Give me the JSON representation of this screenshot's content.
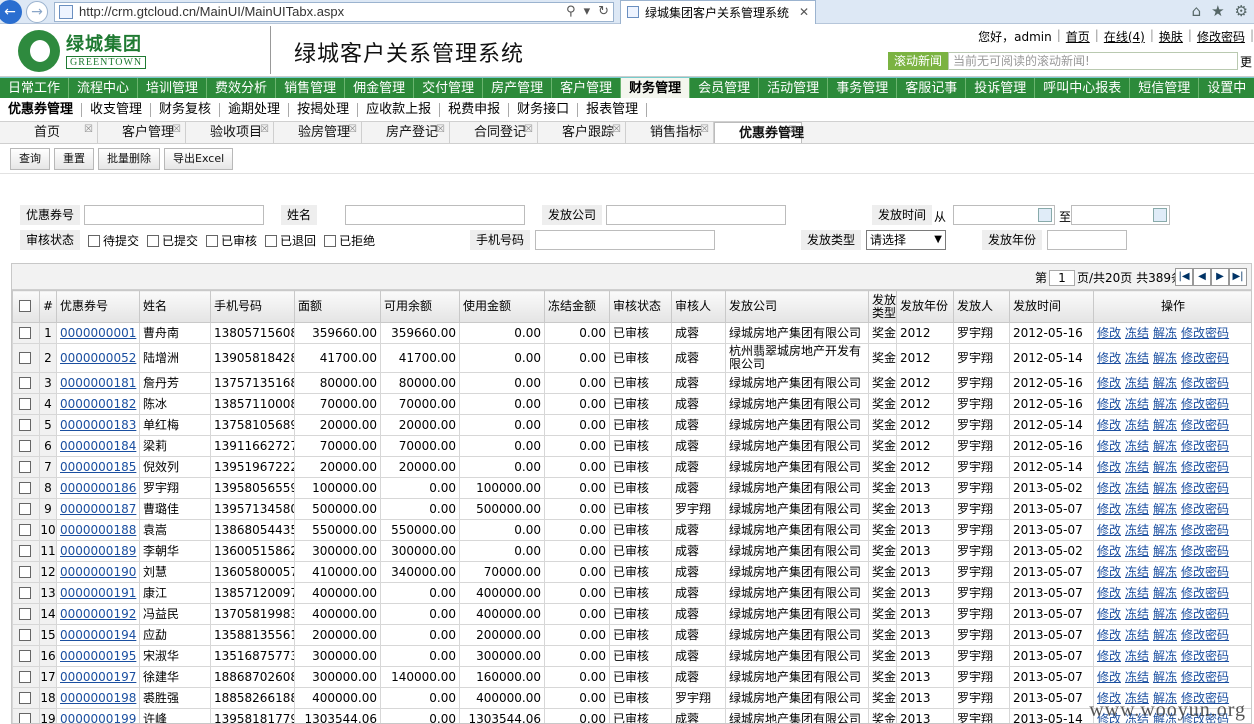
{
  "browser": {
    "url": "http://crm.gtcloud.cn/MainUI/MainUITabx.aspx",
    "tab_title": "绿城集团客户关系管理系统"
  },
  "logo": {
    "cn": "绿城集团",
    "en": "GREENTOWN"
  },
  "system_title": "绿城客户关系管理系统",
  "user": {
    "greeting": "您好，admin",
    "home": "首页",
    "online": "在线(4)",
    "skin": "换肤",
    "change_password": "修改密码"
  },
  "news": {
    "label": "滚动新闻",
    "text": "当前无可阅读的滚动新闻!",
    "more": "更"
  },
  "main_nav": [
    "日常工作",
    "流程中心",
    "培训管理",
    "费效分析",
    "销售管理",
    "佣金管理",
    "交付管理",
    "房产管理",
    "客户管理",
    "财务管理",
    "会员管理",
    "活动管理",
    "事务管理",
    "客服记事",
    "投诉管理",
    "呼叫中心报表",
    "短信管理",
    "设置中"
  ],
  "main_nav_active": 9,
  "sub_nav": [
    "优惠券管理",
    "收支管理",
    "财务复核",
    "逾期处理",
    "按揭处理",
    "应收款上报",
    "税费申报",
    "财务接口",
    "报表管理"
  ],
  "page_tabs": [
    "首页",
    "客户管理",
    "验收项目",
    "验房管理",
    "房产登记",
    "合同登记",
    "客户跟踪",
    "销售指标",
    "优惠券管理"
  ],
  "toolbar": [
    "查询",
    "重置",
    "批量删除",
    "导出Excel"
  ],
  "filters": {
    "coupon_no": "优惠券号",
    "name": "姓名",
    "issuer": "发放公司",
    "issue_time": "发放时间",
    "from": "从",
    "to": "至",
    "audit_status": "审核状态",
    "statuses": [
      "待提交",
      "已提交",
      "已审核",
      "已退回",
      "已拒绝"
    ],
    "phone": "手机号码",
    "issue_type": "发放类型",
    "issue_type_value": "请选择",
    "issue_year": "发放年份"
  },
  "pager": {
    "prefix": "第",
    "page": "1",
    "suffix": "页/共20页 共389条"
  },
  "columns": [
    "#",
    "优惠券号",
    "姓名",
    "手机号码",
    "面额",
    "可用余额",
    "使用金额",
    "冻结金额",
    "审核状态",
    "审核人",
    "发放公司",
    "发放类型",
    "发放年份",
    "发放人",
    "发放时间",
    "操作"
  ],
  "ops": [
    "修改",
    "冻结",
    "解冻",
    "修改密码"
  ],
  "rows": [
    [
      "1",
      "0000000001",
      "曹舟南",
      "13805715608",
      "359660.00",
      "359660.00",
      "0.00",
      "0.00",
      "已审核",
      "成蓉",
      "绿城房地产集团有限公司",
      "奖金",
      "2012",
      "罗宇翔",
      "2012-05-16"
    ],
    [
      "2",
      "0000000052",
      "陆增洲",
      "13905818428",
      "41700.00",
      "41700.00",
      "0.00",
      "0.00",
      "已审核",
      "成蓉",
      "杭州翡翠城房地产开发有限公司",
      "奖金",
      "2012",
      "罗宇翔",
      "2012-05-14"
    ],
    [
      "3",
      "0000000181",
      "詹丹芳",
      "13757135168",
      "80000.00",
      "80000.00",
      "0.00",
      "0.00",
      "已审核",
      "成蓉",
      "绿城房地产集团有限公司",
      "奖金",
      "2012",
      "罗宇翔",
      "2012-05-16"
    ],
    [
      "4",
      "0000000182",
      "陈冰",
      "13857110008",
      "70000.00",
      "70000.00",
      "0.00",
      "0.00",
      "已审核",
      "成蓉",
      "绿城房地产集团有限公司",
      "奖金",
      "2012",
      "罗宇翔",
      "2012-05-16"
    ],
    [
      "5",
      "0000000183",
      "单红梅",
      "13758105689",
      "20000.00",
      "20000.00",
      "0.00",
      "0.00",
      "已审核",
      "成蓉",
      "绿城房地产集团有限公司",
      "奖金",
      "2012",
      "罗宇翔",
      "2012-05-14"
    ],
    [
      "6",
      "0000000184",
      "梁莉",
      "13911662727",
      "70000.00",
      "70000.00",
      "0.00",
      "0.00",
      "已审核",
      "成蓉",
      "绿城房地产集团有限公司",
      "奖金",
      "2012",
      "罗宇翔",
      "2012-05-16"
    ],
    [
      "7",
      "0000000185",
      "倪效列",
      "13951967222",
      "20000.00",
      "20000.00",
      "0.00",
      "0.00",
      "已审核",
      "成蓉",
      "绿城房地产集团有限公司",
      "奖金",
      "2012",
      "罗宇翔",
      "2012-05-14"
    ],
    [
      "8",
      "0000000186",
      "罗宇翔",
      "13958056559",
      "100000.00",
      "0.00",
      "100000.00",
      "0.00",
      "已审核",
      "成蓉",
      "绿城房地产集团有限公司",
      "奖金",
      "2013",
      "罗宇翔",
      "2013-05-02"
    ],
    [
      "9",
      "0000000187",
      "曹璐佳",
      "13957134580",
      "500000.00",
      "0.00",
      "500000.00",
      "0.00",
      "已审核",
      "罗宇翔",
      "绿城房地产集团有限公司",
      "奖金",
      "2013",
      "罗宇翔",
      "2013-05-07"
    ],
    [
      "10",
      "0000000188",
      "袁嵩",
      "13868054435",
      "550000.00",
      "550000.00",
      "0.00",
      "0.00",
      "已审核",
      "成蓉",
      "绿城房地产集团有限公司",
      "奖金",
      "2013",
      "罗宇翔",
      "2013-05-07"
    ],
    [
      "11",
      "0000000189",
      "李朝华",
      "13600515862",
      "300000.00",
      "300000.00",
      "0.00",
      "0.00",
      "已审核",
      "成蓉",
      "绿城房地产集团有限公司",
      "奖金",
      "2013",
      "罗宇翔",
      "2013-05-02"
    ],
    [
      "12",
      "0000000190",
      "刘慧",
      "13605800057",
      "410000.00",
      "340000.00",
      "70000.00",
      "0.00",
      "已审核",
      "成蓉",
      "绿城房地产集团有限公司",
      "奖金",
      "2013",
      "罗宇翔",
      "2013-05-07"
    ],
    [
      "13",
      "0000000191",
      "康江",
      "13857120097",
      "400000.00",
      "0.00",
      "400000.00",
      "0.00",
      "已审核",
      "成蓉",
      "绿城房地产集团有限公司",
      "奖金",
      "2013",
      "罗宇翔",
      "2013-05-07"
    ],
    [
      "14",
      "0000000192",
      "冯益民",
      "13705819983",
      "400000.00",
      "0.00",
      "400000.00",
      "0.00",
      "已审核",
      "成蓉",
      "绿城房地产集团有限公司",
      "奖金",
      "2013",
      "罗宇翔",
      "2013-05-07"
    ],
    [
      "15",
      "0000000194",
      "应勐",
      "13588135561",
      "200000.00",
      "0.00",
      "200000.00",
      "0.00",
      "已审核",
      "成蓉",
      "绿城房地产集团有限公司",
      "奖金",
      "2013",
      "罗宇翔",
      "2013-05-07"
    ],
    [
      "16",
      "0000000195",
      "宋淑华",
      "13516875773",
      "300000.00",
      "0.00",
      "300000.00",
      "0.00",
      "已审核",
      "成蓉",
      "绿城房地产集团有限公司",
      "奖金",
      "2013",
      "罗宇翔",
      "2013-05-07"
    ],
    [
      "17",
      "0000000197",
      "徐建华",
      "18868702608",
      "300000.00",
      "140000.00",
      "160000.00",
      "0.00",
      "已审核",
      "成蓉",
      "绿城房地产集团有限公司",
      "奖金",
      "2013",
      "罗宇翔",
      "2013-05-07"
    ],
    [
      "18",
      "0000000198",
      "裘胜强",
      "18858266188",
      "400000.00",
      "0.00",
      "400000.00",
      "0.00",
      "已审核",
      "罗宇翔",
      "绿城房地产集团有限公司",
      "奖金",
      "2013",
      "罗宇翔",
      "2013-05-07"
    ],
    [
      "19",
      "0000000199",
      "许峰",
      "13958181779",
      "1303544.06",
      "0.00",
      "1303544.06",
      "0.00",
      "已审核",
      "成蓉",
      "绿城房地产集团有限公司",
      "奖金",
      "2013",
      "罗宇翔",
      "2013-05-14"
    ]
  ],
  "watermark": "www.wooyun.org"
}
